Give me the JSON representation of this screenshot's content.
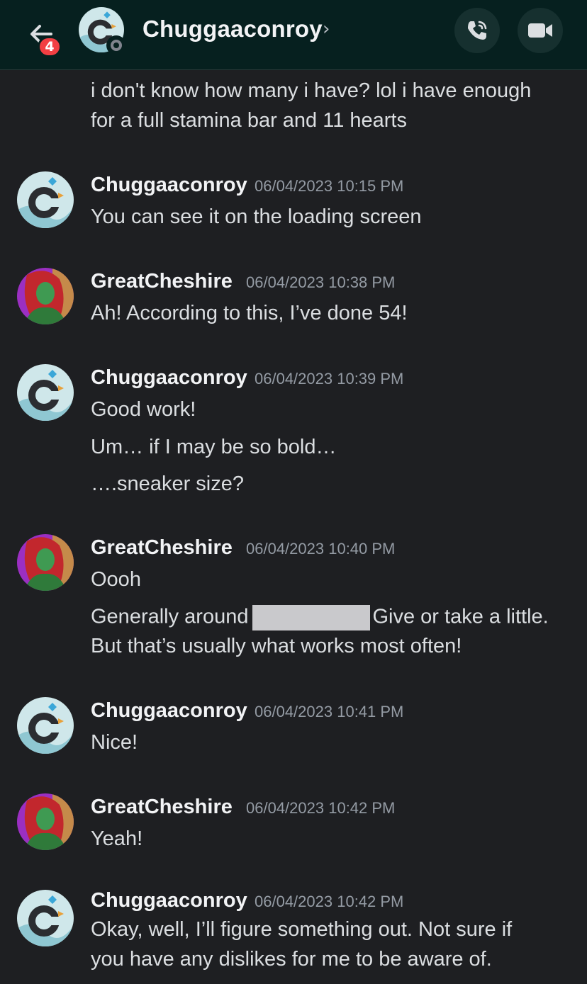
{
  "header": {
    "back_icon": "arrow-left-icon",
    "unread_badge": "4",
    "title": "Chuggaaconroy",
    "chevron": "›",
    "status": "offline",
    "call_icon": "phone-call-icon",
    "video_icon": "video-camera-icon"
  },
  "messages": [
    {
      "continuation": true,
      "lines": [
        "i don't know how many i have? lol i have enough",
        "for a full stamina bar and 11 hearts"
      ]
    },
    {
      "author": "Chuggaaconroy",
      "timestamp": "06/04/2023 10:15 PM",
      "lines": [
        "You can see it on the loading screen"
      ]
    },
    {
      "author": "GreatCheshire",
      "timestamp": "06/04/2023 10:38 PM",
      "lines": [
        "Ah! According to this, I’ve done 54!"
      ]
    },
    {
      "author": "Chuggaaconroy",
      "timestamp": "06/04/2023 10:39 PM",
      "lines": [
        "Good work!",
        "Um… if I may be so bold…",
        "….sneaker size?"
      ]
    },
    {
      "author": "GreatCheshire",
      "timestamp": "06/04/2023 10:40 PM",
      "lines": [
        "Oooh",
        "Generally around",
        "Give or take a little.",
        "But that’s usually what works most often!"
      ]
    },
    {
      "author": "Chuggaaconroy",
      "timestamp": "06/04/2023 10:41 PM",
      "lines": [
        "Nice!"
      ]
    },
    {
      "author": "GreatCheshire",
      "timestamp": "06/04/2023 10:42 PM",
      "lines": [
        "Yeah!"
      ]
    },
    {
      "author": "Chuggaaconroy",
      "timestamp": "06/04/2023 10:42 PM",
      "lines": [
        "Okay, well, I’ll figure something out. Not sure if",
        "you have any dislikes for me to be aware of."
      ]
    }
  ],
  "colors": {
    "background": "#1e1f22",
    "header_bg": "#06201f",
    "badge": "#f23f43",
    "timestamp": "#949ba4",
    "redaction": "#c9c9cc"
  }
}
